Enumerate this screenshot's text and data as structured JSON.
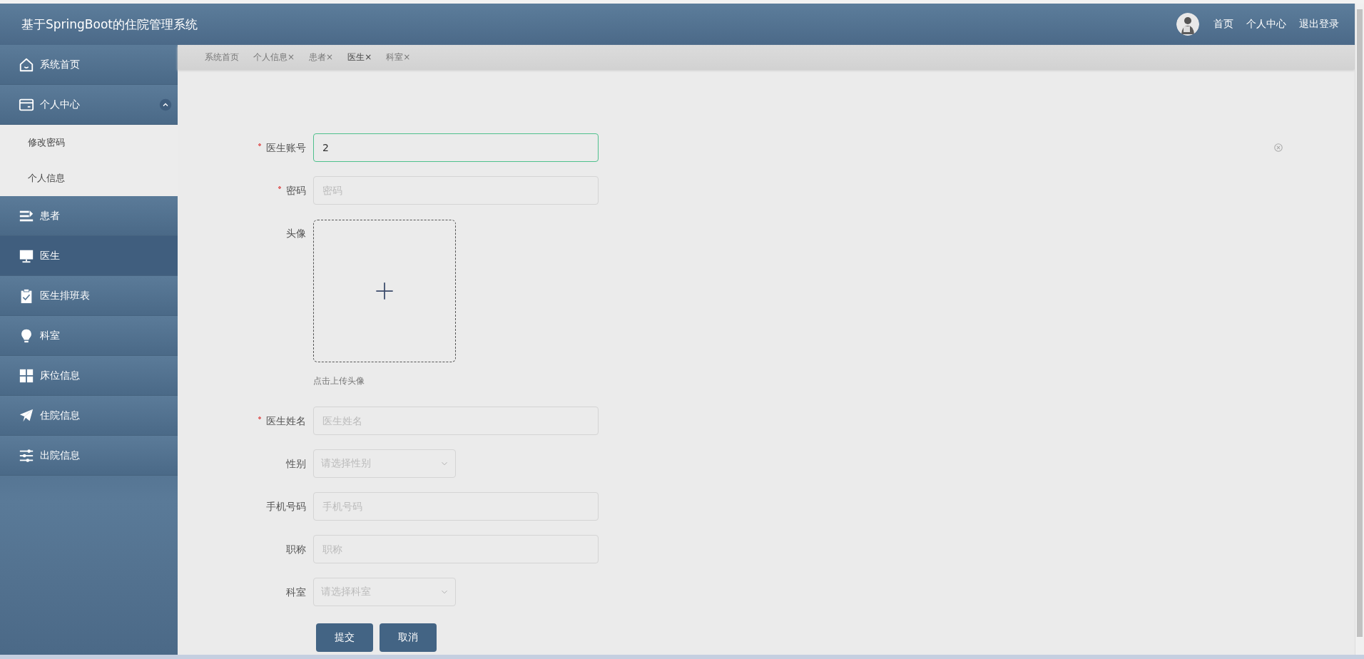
{
  "header": {
    "title": "基于SpringBoot的住院管理系统",
    "nav": [
      "首页",
      "个人中心",
      "退出登录"
    ]
  },
  "sidebar": {
    "items": [
      {
        "label": "系统首页",
        "selected": false
      },
      {
        "label": "个人中心",
        "selected": false,
        "expanded": true,
        "children": [
          {
            "label": "修改密码",
            "selected": false
          },
          {
            "label": "个人信息",
            "selected": false
          }
        ]
      },
      {
        "label": "患者",
        "selected": false
      },
      {
        "label": "医生",
        "selected": true
      },
      {
        "label": "医生排班表",
        "selected": false
      },
      {
        "label": "科室",
        "selected": false
      },
      {
        "label": "床位信息",
        "selected": false
      },
      {
        "label": "住院信息",
        "selected": false
      },
      {
        "label": "出院信息",
        "selected": false
      }
    ]
  },
  "tabs": [
    {
      "label": "系统首页",
      "selected": false
    },
    {
      "label": "个人信息",
      "close": "×",
      "selected": false
    },
    {
      "label": "患者",
      "close": "×",
      "selected": false
    },
    {
      "label": "医生",
      "close": "×",
      "selected": true
    },
    {
      "label": "科室",
      "close": "×",
      "selected": false
    }
  ],
  "form": {
    "fields": [
      {
        "kind": "input",
        "label": "医生账号",
        "required": true,
        "value": "2",
        "focused": true,
        "clearable": true
      },
      {
        "kind": "input",
        "label": "密码",
        "required": true,
        "placeholder": "密码",
        "focused": false
      },
      {
        "kind": "upload",
        "label": "头像",
        "hint": "点击上传头像"
      },
      {
        "kind": "input",
        "label": "医生姓名",
        "required": true,
        "placeholder": "医生姓名",
        "focused": false
      },
      {
        "kind": "select",
        "label": "性别",
        "required": false,
        "placeholder": "请选择性别"
      },
      {
        "kind": "input",
        "label": "手机号码",
        "required": false,
        "placeholder": "手机号码",
        "focused": false
      },
      {
        "kind": "input",
        "label": "职称",
        "required": false,
        "placeholder": "职称",
        "focused": false
      },
      {
        "kind": "select",
        "label": "科室",
        "required": false,
        "placeholder": "请选择科室"
      }
    ],
    "buttons": [
      "提交",
      "取消"
    ]
  }
}
